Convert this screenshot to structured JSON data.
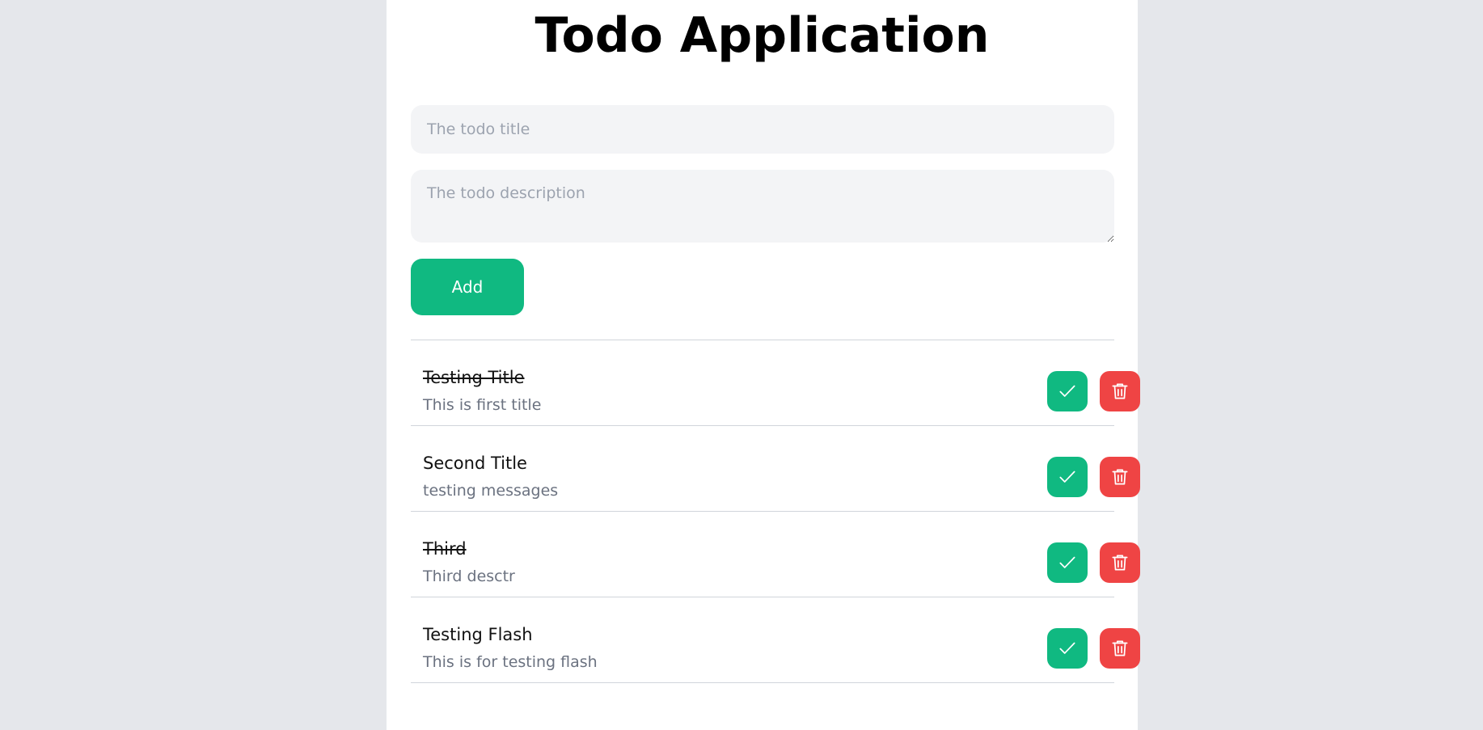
{
  "app": {
    "title": "Todo Application"
  },
  "form": {
    "title_placeholder": "The todo title",
    "title_value": "",
    "description_placeholder": "The todo description",
    "description_value": "",
    "add_label": "Add"
  },
  "todos": [
    {
      "title": "Testing Title",
      "description": "This is first title",
      "completed": true
    },
    {
      "title": "Second Title",
      "description": "testing messages",
      "completed": false
    },
    {
      "title": "Third",
      "description": "Third desctr",
      "completed": true
    },
    {
      "title": "Testing Flash",
      "description": "This is for testing flash",
      "completed": false
    }
  ],
  "icons": {
    "complete": "check-icon",
    "delete": "trash-icon"
  },
  "colors": {
    "background": "#e5e7eb",
    "card": "#ffffff",
    "input_bg": "#f3f4f6",
    "accent_green": "#10b981",
    "danger_red": "#ef4444",
    "muted_text": "#6b7280"
  }
}
